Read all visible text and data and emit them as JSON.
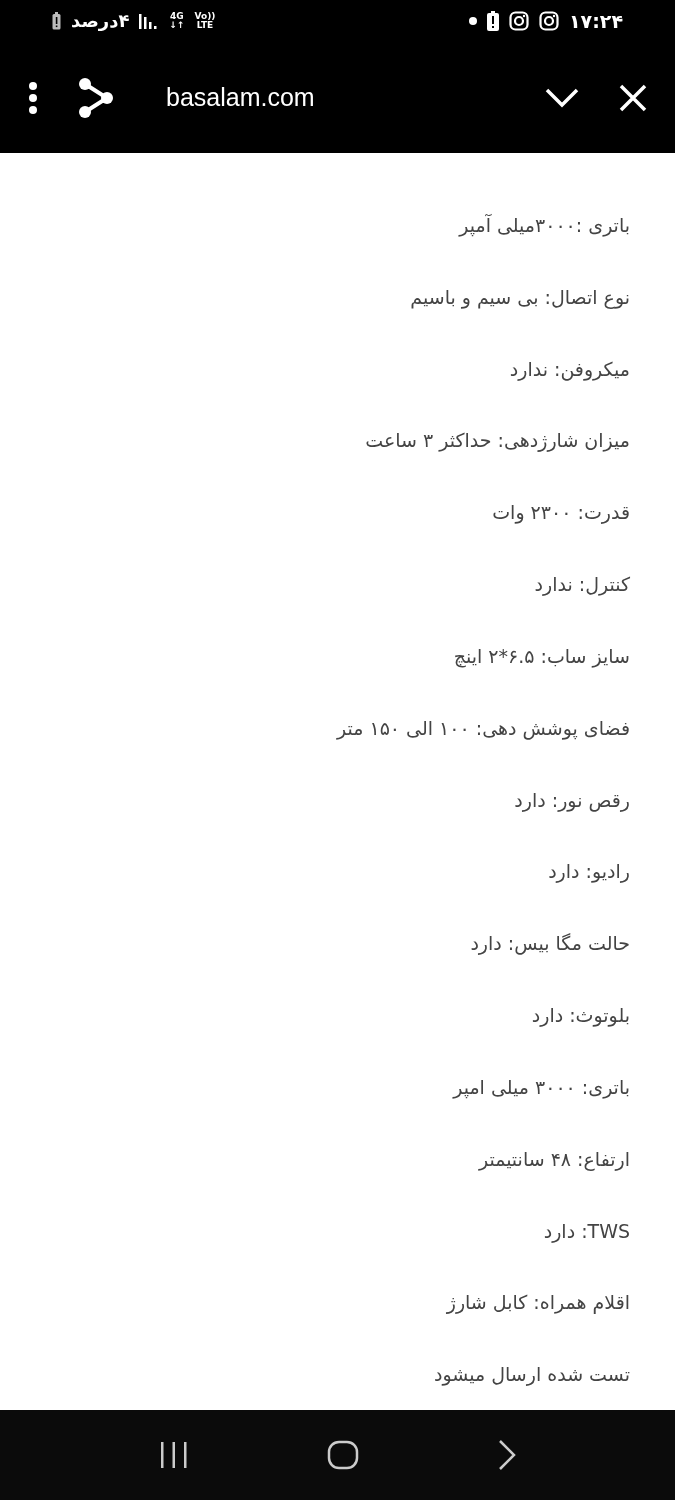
{
  "status_bar": {
    "time": "۱۷:۲۴",
    "battery_text": "۴درصد",
    "network": "4G",
    "network_arrows": "↓↑",
    "volte": "Vo))",
    "volte_sub": "LTE"
  },
  "toolbar": {
    "url": "basalam.com"
  },
  "content": {
    "lines": [
      "باتری :۳۰۰۰میلی آمپر",
      "نوع اتصال: بی سیم و باسیم",
      "میکروفن: ندارد",
      "میزان شارژدهی: حداکثر ۳ ساعت",
      "قدرت: ۲۳۰۰ وات",
      "کنترل: ندارد",
      "سایز ساب: ۶.۵*۲ اینچ",
      "فضای پوشش دهی: ۱۰۰ الی ۱۵۰ متر",
      "رقص نور: دارد",
      "رادیو: دارد",
      "حالت مگا بیس: دارد",
      "بلوتوث: دارد",
      "باتری: ۳۰۰۰ میلی امپر",
      "ارتفاع: ۴۸ سانتیمتر",
      "TWS: دارد",
      "اقلام همراه: کابل شارژ",
      "تست شده ارسال میشود"
    ]
  }
}
